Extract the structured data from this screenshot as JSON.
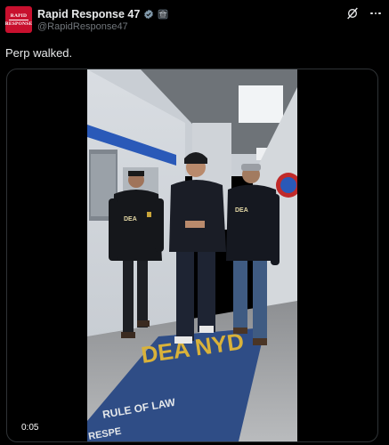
{
  "account": {
    "display_name": "Rapid Response 47",
    "handle": "@RapidResponse47",
    "avatar_text_top": "RAPID",
    "avatar_text_bottom": "RESPONSE",
    "avatar_color": "#c8102e",
    "verified_badge": "verified-badge-icon",
    "affiliate_badge": "government-affiliate-icon"
  },
  "actions": {
    "grok_icon": "grok-icon",
    "more_icon": "more-options-icon"
  },
  "tweet": {
    "text": "Perp walked."
  },
  "video": {
    "timestamp": "0:05",
    "floor_text_line1": "DEA NYD",
    "floor_text_line2": "RULE OF LAW",
    "floor_text_line3": "RESPE",
    "vest_label": "DEA"
  }
}
